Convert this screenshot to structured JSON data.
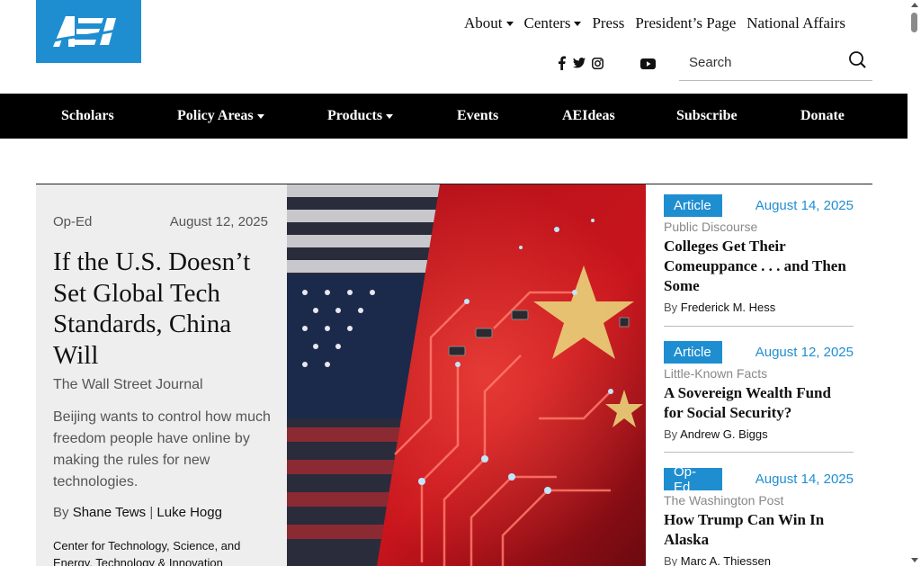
{
  "brand": {
    "logo_text": "AEI",
    "color": "#1f8ed1"
  },
  "topnav": {
    "items": [
      {
        "label": "About",
        "dropdown": true
      },
      {
        "label": "Centers",
        "dropdown": true
      },
      {
        "label": "Press",
        "dropdown": false
      },
      {
        "label": "President’s Page",
        "dropdown": false
      },
      {
        "label": "National Affairs",
        "dropdown": false
      }
    ]
  },
  "social": [
    "facebook-icon",
    "twitter-icon",
    "instagram-icon",
    "youtube-icon"
  ],
  "search": {
    "placeholder": "Search"
  },
  "mainnav": {
    "items": [
      {
        "label": "Scholars"
      },
      {
        "label": "Policy Areas"
      },
      {
        "label": "Products"
      },
      {
        "label": "Events"
      },
      {
        "label": "AEIdeas"
      },
      {
        "label": "Subscribe"
      },
      {
        "label": "Donate"
      }
    ]
  },
  "featured": {
    "type": "Op-Ed",
    "date": "August 12, 2025",
    "title": "If the U.S. Doesn’t Set Global Tech Standards, China Will",
    "source": "The Wall Street Journal",
    "description": "Beijing wants to control how much freedom people have online by making the rules for new technologies.",
    "by": "By",
    "authors": [
      "Shane Tews",
      "Luke Hogg"
    ],
    "author_sep": "|",
    "topics": "Center for Technology, Science, and Energy, Technology & Innovation"
  },
  "articles": [
    {
      "badge": "Article",
      "date": "August 14, 2025",
      "category": "Public Discourse",
      "title": "Colleges Get Their Comeuppance . . . and Then Some",
      "by": "By",
      "author": "Frederick M. Hess"
    },
    {
      "badge": "Article",
      "date": "August 12, 2025",
      "category": "Little-Known Facts",
      "title": "A Sovereign Wealth Fund for Social Security?",
      "by": "By",
      "author": "Andrew G. Biggs"
    },
    {
      "badge": "Op-Ed",
      "date": "August 14, 2025",
      "category": "The Washington Post",
      "title": "How Trump Can Win In Alaska",
      "by": "By",
      "author": "Marc A. Thiessen"
    }
  ]
}
